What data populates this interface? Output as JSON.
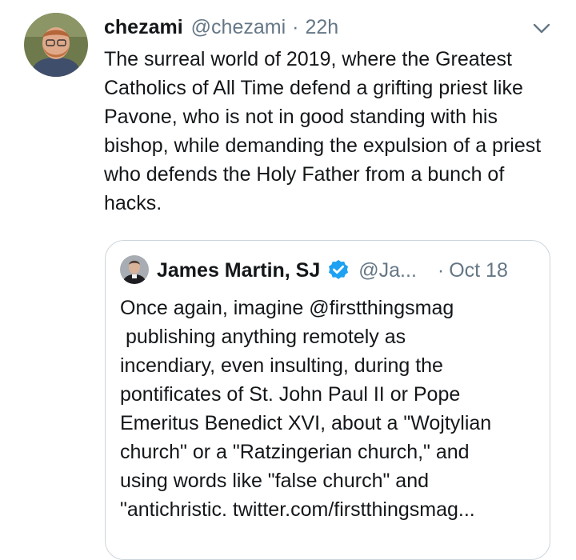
{
  "tweet": {
    "display_name": "chezami",
    "handle": "@chezami",
    "separator": "·",
    "time": "22h",
    "avatar_icon": "user-avatar-icon",
    "menu_icon": "chevron-down-icon",
    "text": "The surreal world of 2019, where the Greatest Catholics of All Time defend a grifting priest like Pavone, who is not in good standing with his bishop, while demanding the expulsion of a priest who defends the Holy Father from a bunch of hacks."
  },
  "quoted_tweet": {
    "display_name": "James Martin, SJ",
    "verified_icon": "verified-badge-icon",
    "handle": "@Ja...",
    "separator": "·",
    "time": "Oct 18",
    "lines": [
      "Once again, imagine @firstthingsmag",
      " publishing anything remotely as",
      "incendiary, even insulting, during the",
      "pontificates of St. John Paul II or Pope",
      "Emeritus Benedict XVI, about a \"Wojtylian",
      "church\" or a \"Ratzingerian church,\" and",
      "using words like \"false church\" and",
      "\"antichristic. twitter.com/firstthingsmag..."
    ]
  },
  "colors": {
    "text": "#14171a",
    "secondary": "#657786",
    "border": "#ccd6dd",
    "verified": "#1da1f2"
  }
}
